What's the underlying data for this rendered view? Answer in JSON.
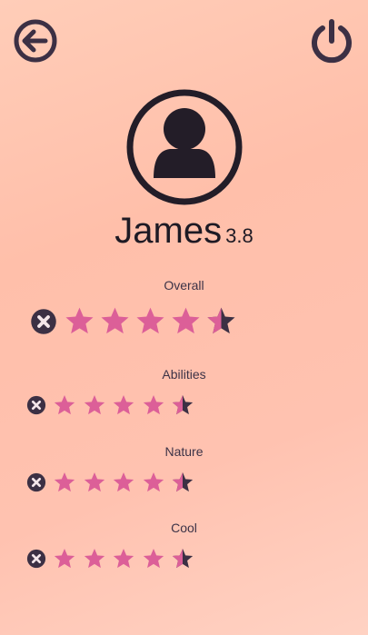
{
  "colors": {
    "dark": "#3c3044",
    "star": "#dc5f98",
    "bg_start": "#ffcdb8",
    "bg_end": "#ffd2c3"
  },
  "header": {
    "back_icon": "arrow-left-circle-icon",
    "power_icon": "power-icon"
  },
  "profile": {
    "avatar_icon": "user-circle-icon",
    "name": "James",
    "score": "3.8"
  },
  "ratings": [
    {
      "label": "Overall",
      "value": 4.5,
      "max": 5
    },
    {
      "label": "Abilities",
      "value": 4.5,
      "max": 5
    },
    {
      "label": "Nature",
      "value": 4.5,
      "max": 5
    },
    {
      "label": "Cool",
      "value": 4.5,
      "max": 5
    }
  ]
}
